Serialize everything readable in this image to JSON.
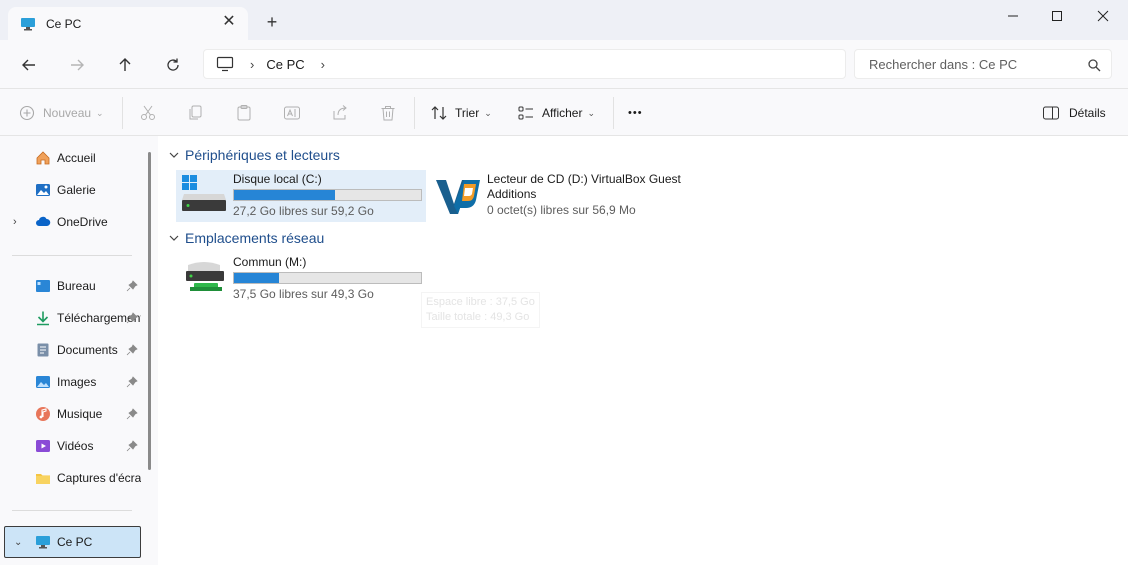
{
  "tab": {
    "title": "Ce PC",
    "close_glyph": "✕",
    "new_tab_glyph": "+"
  },
  "window_controls": {
    "minimize": "minimize-icon",
    "maximize": "maximize-icon",
    "close": "close-icon"
  },
  "navigation": {
    "breadcrumb": [
      "Ce PC"
    ],
    "search_placeholder": "Rechercher dans : Ce PC"
  },
  "toolbar": {
    "new_label": "Nouveau",
    "sort_label": "Trier",
    "view_label": "Afficher",
    "more_label": "•••",
    "details_label": "Détails"
  },
  "sidebar": {
    "quick": [
      {
        "label": "Accueil",
        "icon": "home-icon"
      },
      {
        "label": "Galerie",
        "icon": "gallery-icon"
      },
      {
        "label": "OneDrive",
        "icon": "cloud-icon"
      }
    ],
    "pinned": [
      {
        "label": "Bureau",
        "icon": "desktop-icon"
      },
      {
        "label": "Téléchargements",
        "icon": "download-icon"
      },
      {
        "label": "Documents",
        "icon": "documents-icon"
      },
      {
        "label": "Images",
        "icon": "images-icon"
      },
      {
        "label": "Musique",
        "icon": "music-icon"
      },
      {
        "label": "Vidéos",
        "icon": "videos-icon"
      },
      {
        "label": "Captures d'écran",
        "icon": "folder-icon"
      }
    ],
    "this_pc": "Ce PC"
  },
  "content": {
    "devices_header": "Périphériques et lecteurs",
    "network_header": "Emplacements réseau",
    "drives": [
      {
        "name": "Disque local (C:)",
        "free": "27,2 Go libres sur 59,2 Go",
        "used_fraction": 0.54
      }
    ],
    "cd": {
      "name": "Lecteur de CD (D:) VirtualBox Guest Additions",
      "free": "0 octet(s) libres sur 56,9 Mo"
    },
    "network": [
      {
        "name": "Commun (M:)",
        "free": "37,5 Go libres sur 49,3 Go",
        "used_fraction": 0.24
      }
    ],
    "tooltip": {
      "line1": "Espace libre : 37,5 Go",
      "line2": "Taille totale : 49,3 Go"
    }
  },
  "colors": {
    "accent": "#2685d6",
    "header_text": "#1f4e8c",
    "selection": "#cce4f7"
  }
}
